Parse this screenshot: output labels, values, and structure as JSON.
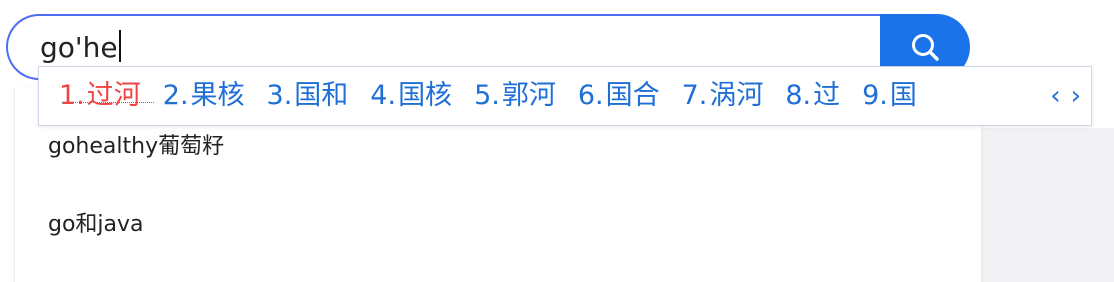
{
  "search": {
    "query": "go'he",
    "button_icon": "search-icon"
  },
  "suggestions": [
    {
      "text": "gohealthy葡萄籽"
    },
    {
      "text": "go和java"
    }
  ],
  "ime": {
    "candidates": [
      {
        "num": "1.",
        "text": "过河"
      },
      {
        "num": "2.",
        "text": "果核"
      },
      {
        "num": "3.",
        "text": "国和"
      },
      {
        "num": "4.",
        "text": "国核"
      },
      {
        "num": "5.",
        "text": "郭河"
      },
      {
        "num": "6.",
        "text": "国合"
      },
      {
        "num": "7.",
        "text": "涡河"
      },
      {
        "num": "8.",
        "text": "过"
      },
      {
        "num": "9.",
        "text": "国"
      }
    ],
    "prev_label": "‹",
    "next_label": "›",
    "selected_color": "#ee4444",
    "candidate_color": "#1f6fd6"
  },
  "colors": {
    "accent": "#1a73e8",
    "border": "#4e6ef2"
  }
}
